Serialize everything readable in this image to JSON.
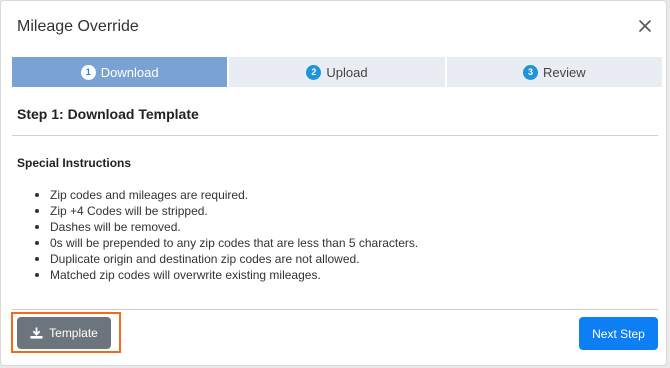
{
  "modal": {
    "title": "Mileage Override"
  },
  "stepper": {
    "steps": [
      {
        "number": "1",
        "label": "Download",
        "active": true
      },
      {
        "number": "2",
        "label": "Upload",
        "active": false
      },
      {
        "number": "3",
        "label": "Review",
        "active": false
      }
    ]
  },
  "content": {
    "section_title": "Step 1: Download Template",
    "instructions_title": "Special Instructions",
    "instructions": [
      "Zip codes and mileages are required.",
      "Zip +4 Codes will be stripped.",
      "Dashes will be removed.",
      "0s will be prepended to any zip codes that are less than 5 characters.",
      "Duplicate origin and destination zip codes are not allowed.",
      "Matched zip codes will overwrite existing mileages."
    ]
  },
  "footer": {
    "template_label": "Template",
    "next_label": "Next Step"
  },
  "colors": {
    "active_step": "#7aa2d4",
    "primary": "#0d7ff2",
    "secondary": "#6c757d",
    "highlight": "#f26b1d"
  }
}
